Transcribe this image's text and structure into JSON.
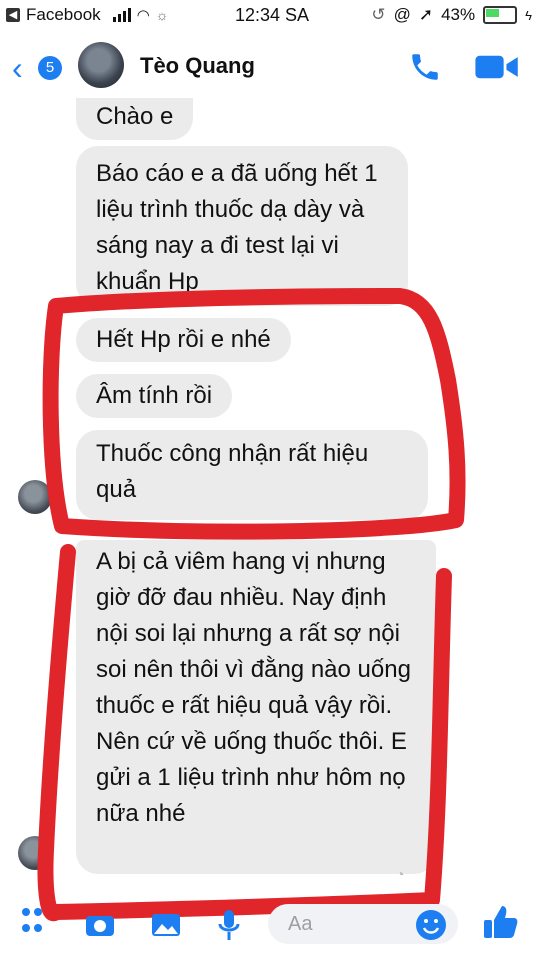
{
  "status_bar": {
    "back_app": "Facebook",
    "time": "12:34 SA",
    "battery": "43%"
  },
  "header": {
    "unread_count": "5",
    "contact_name": "Tèo Quang"
  },
  "messages": [
    {
      "text": "Chào e"
    },
    {
      "text": "Báo cáo e a đã uống hết 1 liệu trình thuốc dạ dày và sáng nay a đi test lại vi khuẩn Hp"
    },
    {
      "text": "Hết Hp rồi e nhé"
    },
    {
      "text": "Âm tính rồi"
    },
    {
      "text": "Thuốc công nhận rất hiệu quả"
    },
    {
      "text": "A bị cả viêm hang vị nhưng giờ đỡ đau nhiều. Nay định nội soi lại nhưng a rất sợ nội soi nên thôi vì đằng nào uống thuốc e rất hiệu quả vậy rồi. Nên cứ về uống thuốc thôi. E gửi a 1 liệu trình như hôm nọ nữa nhé"
    }
  ],
  "composer": {
    "placeholder": "Aa"
  },
  "colors": {
    "accent": "#1c7ef0",
    "bubble": "#ebebeb",
    "marker": "#e0262b"
  },
  "icons": [
    "chevron-left-icon",
    "phone-icon",
    "video-camera-icon",
    "apps-icon",
    "camera-icon",
    "image-icon",
    "microphone-icon",
    "emoji-icon",
    "thumbs-up-icon"
  ]
}
